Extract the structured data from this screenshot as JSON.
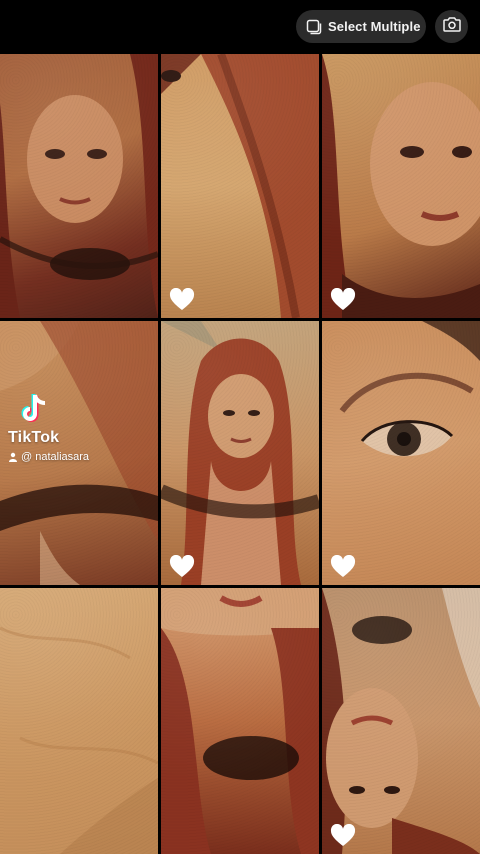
{
  "toolbar": {
    "select_multiple_label": "Select Multiple",
    "select_icon": "square-stack-icon",
    "camera_icon": "camera-icon"
  },
  "grid": {
    "columns": 3,
    "rows": 3,
    "items": [
      {
        "type": "video",
        "liked": false
      },
      {
        "type": "video",
        "liked": true
      },
      {
        "type": "video",
        "liked": true
      },
      {
        "type": "video",
        "liked": false,
        "watermark": true
      },
      {
        "type": "video",
        "liked": true
      },
      {
        "type": "video",
        "liked": true
      },
      {
        "type": "video",
        "liked": false
      },
      {
        "type": "video",
        "liked": false
      },
      {
        "type": "video",
        "liked": true
      }
    ]
  },
  "watermark": {
    "brand": "TikTok",
    "username": "@ nataliasara",
    "logo_icon": "tiktok-logo-icon"
  },
  "colors": {
    "background": "#000000",
    "button_bg": "#2b2b2b",
    "button_text": "#f2f2f2",
    "heart": "#ffffff",
    "photo_warm": "#c98a4a",
    "hair_red": "#8a3a22"
  }
}
